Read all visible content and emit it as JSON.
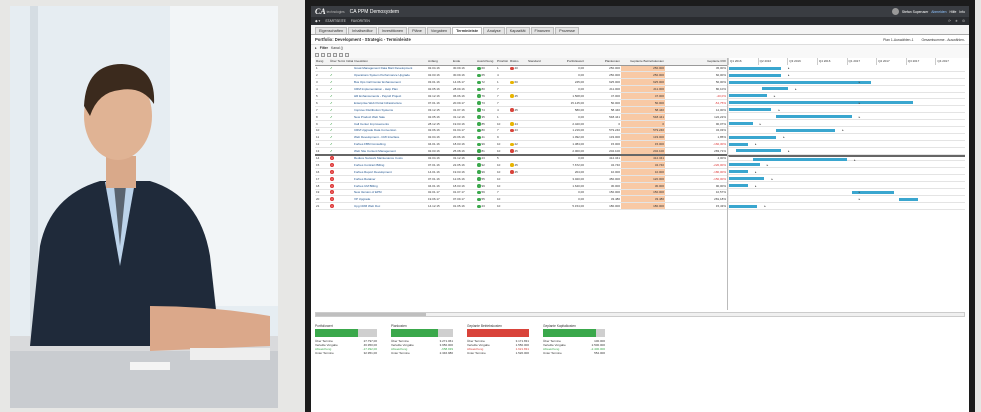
{
  "app": {
    "brand_logo": "CA",
    "brand_sub": "technologies",
    "title": "CA PPM Demosystem",
    "user_name": "Stefan Superuser",
    "user_links": [
      "Abmelden",
      "Hilfe",
      "Info"
    ]
  },
  "nav": {
    "items": [
      "STARTSEITE",
      "FAVORITEN"
    ],
    "right_icons": [
      "refresh-icon",
      "star-icon",
      "gear-icon"
    ]
  },
  "tabs": [
    {
      "label": "Eigenschaften",
      "active": false
    },
    {
      "label": "Inhaltsedltor",
      "active": false
    },
    {
      "label": "Investitionen",
      "active": false
    },
    {
      "label": "Pläne",
      "active": false
    },
    {
      "label": "Vorgaben",
      "active": false
    },
    {
      "label": "Terminleiste",
      "active": true
    },
    {
      "label": "Analyse",
      "active": false
    },
    {
      "label": "Kapazität",
      "active": false
    },
    {
      "label": "Finanzen",
      "active": false
    },
    {
      "label": "Prozesse",
      "active": false
    }
  ],
  "crumb": "Portfolio: Development - Strategic - Terminleiste",
  "crumb_right": [
    "Plan 1-Auswählen-1",
    "Gesamtsumme - Auswählen-"
  ],
  "filter": {
    "label": "Filter",
    "value": "Kanal ()"
  },
  "columns": [
    "Rang",
    "Über Termine",
    "Initiative",
    "Investition",
    "Anfang",
    "Ende",
    "Ausrichtung",
    "Priorität",
    "Risiko",
    "Standard",
    "Portfoliowert",
    "Plankosten",
    "Geplante Betriebskosten",
    "Geplante ROI"
  ],
  "timeline": [
    "Q1 2016",
    "Q2 2016",
    "Q3 2016",
    "Q4 2016",
    "Q1 2017",
    "Q2 2017",
    "Q3 2017",
    "Q4 2017"
  ],
  "rows": [
    {
      "rank": "1",
      "ok": true,
      "name": "Great Management Data Mart Development",
      "start": "02.04.16",
      "end": "30.09.16",
      "align": "60",
      "prio": "1",
      "risk": "40",
      "std": "",
      "pv": "0,00",
      "pk": "250.000",
      "pb": "250.000",
      "roi": "45,00%",
      "bs": 0.0,
      "be": 0.22
    },
    {
      "rank": "2",
      "ok": true,
      "name": "Operations System Performance Upgrade",
      "start": "02.03.16",
      "end": "30.09.16",
      "align": "65",
      "prio": "4",
      "risk": "",
      "std": "",
      "pv": "0,00",
      "pk": "250.000",
      "pb": "250.000",
      "roi": "60,00%",
      "bs": 0.0,
      "be": 0.22
    },
    {
      "rank": "3",
      "ok": true,
      "name": "Bus Ops Call Center Enhancement",
      "start": "03.01.16",
      "end": "14.06.17",
      "align": "72",
      "prio": "1",
      "risk": "60",
      "std": "",
      "pv": "245,00",
      "pk": "625.000",
      "pb": "625.000",
      "roi": "50,00%",
      "bs": 0.0,
      "be": 0.6
    },
    {
      "rank": "4",
      "ok": true,
      "name": "CRM Implementation - Help Plan",
      "start": "02.05.16",
      "end": "28.09.16",
      "align": "80",
      "prio": "7",
      "risk": "",
      "std": "",
      "pv": "0,00",
      "pk": "211.000",
      "pb": "211.000",
      "roi": "80,10%",
      "bs": 0.14,
      "be": 0.25
    },
    {
      "rank": "5",
      "ok": true,
      "name": "HR Enhancements - Payroll Project",
      "start": "02.12.16",
      "end": "06.06.16",
      "align": "76",
      "prio": "7",
      "risk": "45",
      "std": "",
      "pv": "1.508,00",
      "pk": "47.000",
      "pb": "47.000",
      "roi": "-20,0%",
      "bs": 0.0,
      "be": 0.16
    },
    {
      "rank": "6",
      "ok": true,
      "name": "Enterprise Web Portal Infrastructure",
      "start": "07.01.16",
      "end": "20.09.17",
      "align": "73",
      "prio": "7",
      "risk": "",
      "std": "",
      "pv": "15.145,00",
      "pk": "50.000",
      "pb": "50.000",
      "roi": "-54,75%",
      "bs": 0.0,
      "be": 0.78
    },
    {
      "rank": "7",
      "ok": true,
      "name": "Improve Distribution Systems",
      "start": "03.12.15",
      "end": "31.07.16",
      "align": "74",
      "prio": "4",
      "risk": "45",
      "std": "",
      "pv": "580,00",
      "pk": "58.440",
      "pb": "58.440",
      "roi": "12,00%",
      "bs": 0.0,
      "be": 0.18
    },
    {
      "rank": "8",
      "ok": true,
      "name": "New Product Web Sale",
      "start": "02.05.16",
      "end": "31.12.16",
      "align": "35",
      "prio": "1",
      "risk": "",
      "std": "",
      "pv": "0,00",
      "pk": "548.441",
      "pb": "548.441",
      "roi": "122,22%",
      "bs": 0.2,
      "be": 0.52
    },
    {
      "rank": "9",
      "ok": true,
      "name": "Call Center Improvements",
      "start": "28.12.15",
      "end": "19.03.16",
      "align": "85",
      "prio": "10",
      "risk": "44",
      "std": "",
      "pv": "2.420,00",
      "pk": "0",
      "pb": "0",
      "roi": "90,07%",
      "bs": 0.0,
      "be": 0.1
    },
    {
      "rank": "10",
      "ok": true,
      "name": "CRM Upgrade Data Conversion",
      "start": "02.06.16",
      "end": "01.04.17",
      "align": "80",
      "prio": "7",
      "risk": "43",
      "std": "",
      "pv": "1.219,00",
      "pk": "579.240",
      "pb": "579.240",
      "roi": "34,03%",
      "bs": 0.2,
      "be": 0.45
    },
    {
      "rank": "11",
      "ok": true,
      "name": "Web Development - CMI Interface",
      "start": "02.04.16",
      "end": "20.06.16",
      "align": "41",
      "prio": "9",
      "risk": "",
      "std": "",
      "pv": "1.092,00",
      "pk": "133.000",
      "pb": "133.000",
      "roi": "1,85%",
      "bs": 0.0,
      "be": 0.2
    },
    {
      "rank": "12",
      "ok": true,
      "name": "Forbes FBM Consulting",
      "start": "04.01.16",
      "end": "18.03.16",
      "align": "99",
      "prio": "10",
      "risk": "22",
      "std": "",
      "pv": "1.384,00",
      "pk": "15.000",
      "pb": "15.000",
      "roi": "-160,30%",
      "bs": 0.0,
      "be": 0.08
    },
    {
      "rank": "13",
      "ok": true,
      "name": "Web Site Content Management",
      "start": "02.03.16",
      "end": "25.08.16",
      "align": "81",
      "prio": "10",
      "risk": "45",
      "std": "",
      "pv": "2.000,00",
      "pk": "202.100",
      "pb": "202.100",
      "roi": "283,71%",
      "bs": 0.03,
      "be": 0.22
    },
    {
      "rank": "14",
      "ok": false,
      "name": "Reduce Network Maintenance Costs",
      "start": "02.04.16",
      "end": "31.12.16",
      "align": "23",
      "prio": "5",
      "risk": "",
      "std": "",
      "pv": "0,00",
      "pk": "412.341",
      "pb": "412.341",
      "roi": "4,00%",
      "bs": 0.1,
      "be": 0.5
    },
    {
      "rank": "15",
      "ok": false,
      "name": "Forbes Contract Billing",
      "start": "07.01.16",
      "end": "22.05.16",
      "align": "92",
      "prio": "10",
      "risk": "45",
      "std": "",
      "pv": "7.672,00",
      "pk": "34.740",
      "pb": "34.740",
      "roi": "-220,00%",
      "bs": 0.0,
      "be": 0.13
    },
    {
      "rank": "16",
      "ok": false,
      "name": "Forbes Report Development",
      "start": "14.01.16",
      "end": "19.03.16",
      "align": "99",
      "prio": "10",
      "risk": "45",
      "std": "",
      "pv": "204,00",
      "pk": "10.000",
      "pb": "10.000",
      "roi": "-180,00%",
      "bs": 0.0,
      "be": 0.08
    },
    {
      "rank": "17",
      "ok": false,
      "name": "Forbes Retainer",
      "start": "07.01.16",
      "end": "12.06.16",
      "align": "55",
      "prio": "10",
      "risk": "",
      "std": "",
      "pv": "3.020,00",
      "pk": "450.000",
      "pb": "120.000",
      "roi": "-150,00%",
      "bs": 0.0,
      "be": 0.15
    },
    {
      "rank": "18",
      "ok": false,
      "name": "Forbes UM Billing",
      "start": "04.01.16",
      "end": "18.03.16",
      "align": "99",
      "prio": "10",
      "risk": "",
      "std": "",
      "pv": "1.640,00",
      "pk": "30.000",
      "pb": "30.000",
      "roi": "90,00%",
      "bs": 0.0,
      "be": 0.08
    },
    {
      "rank": "19",
      "ok": false,
      "name": "New Version of EPM",
      "start": "02.01.17",
      "end": "01.07.17",
      "align": "59",
      "prio": "7",
      "risk": "",
      "std": "",
      "pv": "0,00",
      "pk": "150.000",
      "pb": "150.000",
      "roi": "10,57%",
      "bs": 0.52,
      "be": 0.7
    },
    {
      "rank": "20",
      "ok": false,
      "name": "VP Upgrade",
      "start": "19.06.17",
      "end": "07.09.17",
      "align": "55",
      "prio": "10",
      "risk": "",
      "std": "",
      "pv": "0,00",
      "pk": "33.480",
      "pb": "33.480",
      "roi": "281,18%",
      "bs": 0.72,
      "be": 0.8
    },
    {
      "rank": "21",
      "ok": false,
      "name": "Upg CRM Web Doc",
      "start": "14.12.15",
      "end": "01.05.16",
      "align": "23",
      "prio": "10",
      "risk": "",
      "std": "",
      "pv": "5.154,00",
      "pk": "180.000",
      "pb": "180.000",
      "roi": "15,43%",
      "bs": 0.0,
      "be": 0.12
    }
  ],
  "summary": [
    {
      "title": "Portfoliowert",
      "bar_green": 0.7,
      "bar_red": 0,
      "lines": [
        [
          "Über Termine",
          "27.797,00"
        ],
        [
          "Verteilte Vorgabe",
          "46.950,00"
        ],
        [
          "Abweichung",
          "-17.392,00"
        ],
        [
          "Unter Termine",
          "32.951,00"
        ]
      ]
    },
    {
      "title": "Plankosten",
      "bar_green": 0.75,
      "bar_red": 0,
      "lines": [
        [
          "Über Termine",
          "3.271.061"
        ],
        [
          "Verteilte Vorgabe",
          "3.950.000"
        ],
        [
          "Abweichung",
          "-658.939"
        ],
        [
          "Unter Termine",
          "2.346.980"
        ]
      ]
    },
    {
      "title": "Geplante Betriebskosten",
      "bar_green": 0,
      "bar_red": 1.0,
      "lines": [
        [
          "Über Termine",
          "3.171.831"
        ],
        [
          "Verteilte Vorgabe",
          "1.550.000"
        ],
        [
          "Abweichung",
          "1.621.831"
        ],
        [
          "Unter Termine",
          "1.520.000"
        ]
      ]
    },
    {
      "title": "Geplante Kapitalkosten",
      "bar_green": 0.85,
      "bar_red": 0,
      "lines": [
        [
          "Über Termine",
          "100.000"
        ],
        [
          "Verteilte Vorgabe",
          "2.500.000"
        ],
        [
          "Abweichung",
          "-2.400.000"
        ],
        [
          "Unter Termine",
          "552.000"
        ]
      ]
    }
  ],
  "colors": {
    "bar": "#3aa6cf",
    "peach": "#f8c9a5",
    "green": "#3aa84b",
    "red": "#d9433a"
  }
}
